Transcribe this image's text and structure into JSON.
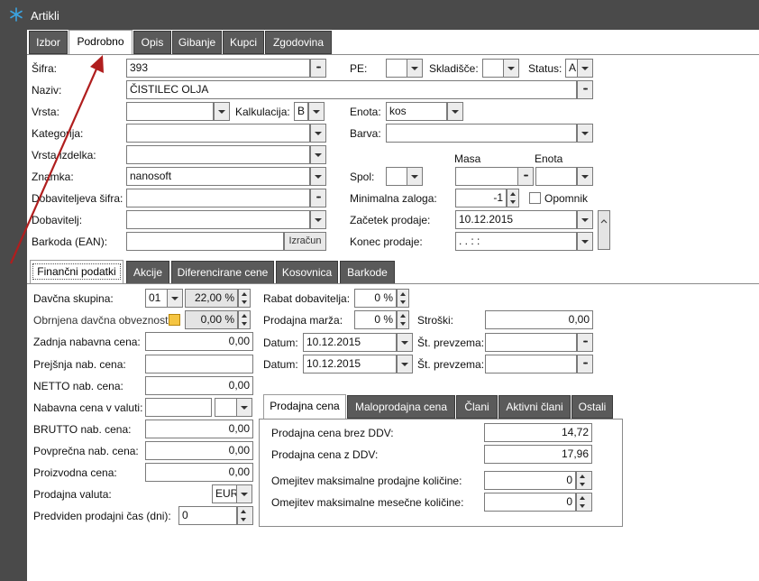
{
  "window": {
    "title": "Artikli"
  },
  "top_tabs": [
    {
      "label": "Izbor"
    },
    {
      "label": "Podrobno"
    },
    {
      "label": "Opis"
    },
    {
      "label": "Gibanje"
    },
    {
      "label": "Kupci"
    },
    {
      "label": "Zgodovina"
    }
  ],
  "form": {
    "sifra_label": "Šifra:",
    "sifra_value": "393",
    "pe_label": "PE:",
    "skladisce_label": "Skladišče:",
    "status_label": "Status:",
    "status_value": "A",
    "naziv_label": "Naziv:",
    "naziv_value": "ČISTILEC OLJA",
    "vrsta_label": "Vrsta:",
    "kalkulacija_label": "Kalkulacija:",
    "kalkulacija_value": "B",
    "enota_label": "Enota:",
    "enota_value": "kos",
    "kategorija_label": "Kategorija:",
    "barva_label": "Barva:",
    "vrsta_izdelka_label": "Vrsta izdelka:",
    "masa_header": "Masa",
    "enota_header": "Enota",
    "znamka_label": "Znamka:",
    "znamka_value": "nanosoft",
    "spol_label": "Spol:",
    "dobaviteljeva_sifra_label": "Dobaviteljeva šifra:",
    "minimalna_zaloga_label": "Minimalna zaloga:",
    "minimalna_zaloga_value": "-1",
    "opomnik_label": "Opomnik",
    "dobavitelj_label": "Dobavitelj:",
    "zacetek_prodaje_label": "Začetek prodaje:",
    "zacetek_prodaje_value": "10.12.2015",
    "barkoda_label": "Barkoda (EAN):",
    "izracun_label": "Izračun",
    "konec_prodaje_label": "Konec prodaje:",
    "konec_prodaje_value": ". .      : :"
  },
  "sub_tabs": [
    {
      "label": "Finančni podatki"
    },
    {
      "label": "Akcije"
    },
    {
      "label": "Diferencirane cene"
    },
    {
      "label": "Kosovnica"
    },
    {
      "label": "Barkode"
    }
  ],
  "finance": {
    "davcna_skupina_label": "Davčna skupina:",
    "davcna_skupina_code": "01",
    "davcna_skupina_pct": "22,00 %",
    "obrnjena_label": "Obrnjena davčna obveznost",
    "obrnjena_pct": "0,00 %",
    "zadnja_label": "Zadnja nabavna cena:",
    "zadnja_value": "0,00",
    "prejsnja_label": "Prejšnja nab. cena:",
    "prejsnja_value": "",
    "netto_label": "NETTO nab. cena:",
    "netto_value": "0,00",
    "nabavna_valuta_label": "Nabavna cena v valuti:",
    "brutto_label": "BRUTTO nab. cena:",
    "brutto_value": "0,00",
    "povprecna_label": "Povprečna nab. cena:",
    "povprecna_value": "0,00",
    "proizvodna_label": "Proizvodna cena:",
    "proizvodna_value": "0,00",
    "prodajna_valuta_label": "Prodajna valuta:",
    "prodajna_valuta_value": "EUR",
    "predviden_label": "Predviden prodajni čas (dni):",
    "predviden_value": "0",
    "rabat_label": "Rabat dobavitelja:",
    "rabat_value": "0 %",
    "marza_label": "Prodajna marža:",
    "marza_value": "0 %",
    "stroski_label": "Stroški:",
    "stroski_value": "0,00",
    "datum1_label": "Datum:",
    "datum1_value": "10.12.2015",
    "st_prevzema1_label": "Št. prevzema:",
    "datum2_label": "Datum:",
    "datum2_value": "10.12.2015",
    "st_prevzema2_label": "Št. prevzema:"
  },
  "price_tabs": [
    {
      "label": "Prodajna cena"
    },
    {
      "label": "Maloprodajna cena"
    },
    {
      "label": "Člani"
    },
    {
      "label": "Aktivni člani"
    },
    {
      "label": "Ostali"
    }
  ],
  "prices": {
    "brez_ddv_label": "Prodajna cena brez DDV:",
    "brez_ddv_value": "14,72",
    "z_ddv_label": "Prodajna cena z DDV:",
    "z_ddv_value": "17,96",
    "omejitev_prod_label": "Omejitev maksimalne prodajne količine:",
    "omejitev_prod_value": "0",
    "omejitev_mes_label": "Omejitev maksimalne mesečne količine:",
    "omejitev_mes_value": "0"
  },
  "colors": {
    "titlebar": "#4a4a4a",
    "tab_inactive": "#5a5a5a",
    "annotation_arrow": "#b01e1e",
    "app_icon": "#3ba3e0"
  }
}
